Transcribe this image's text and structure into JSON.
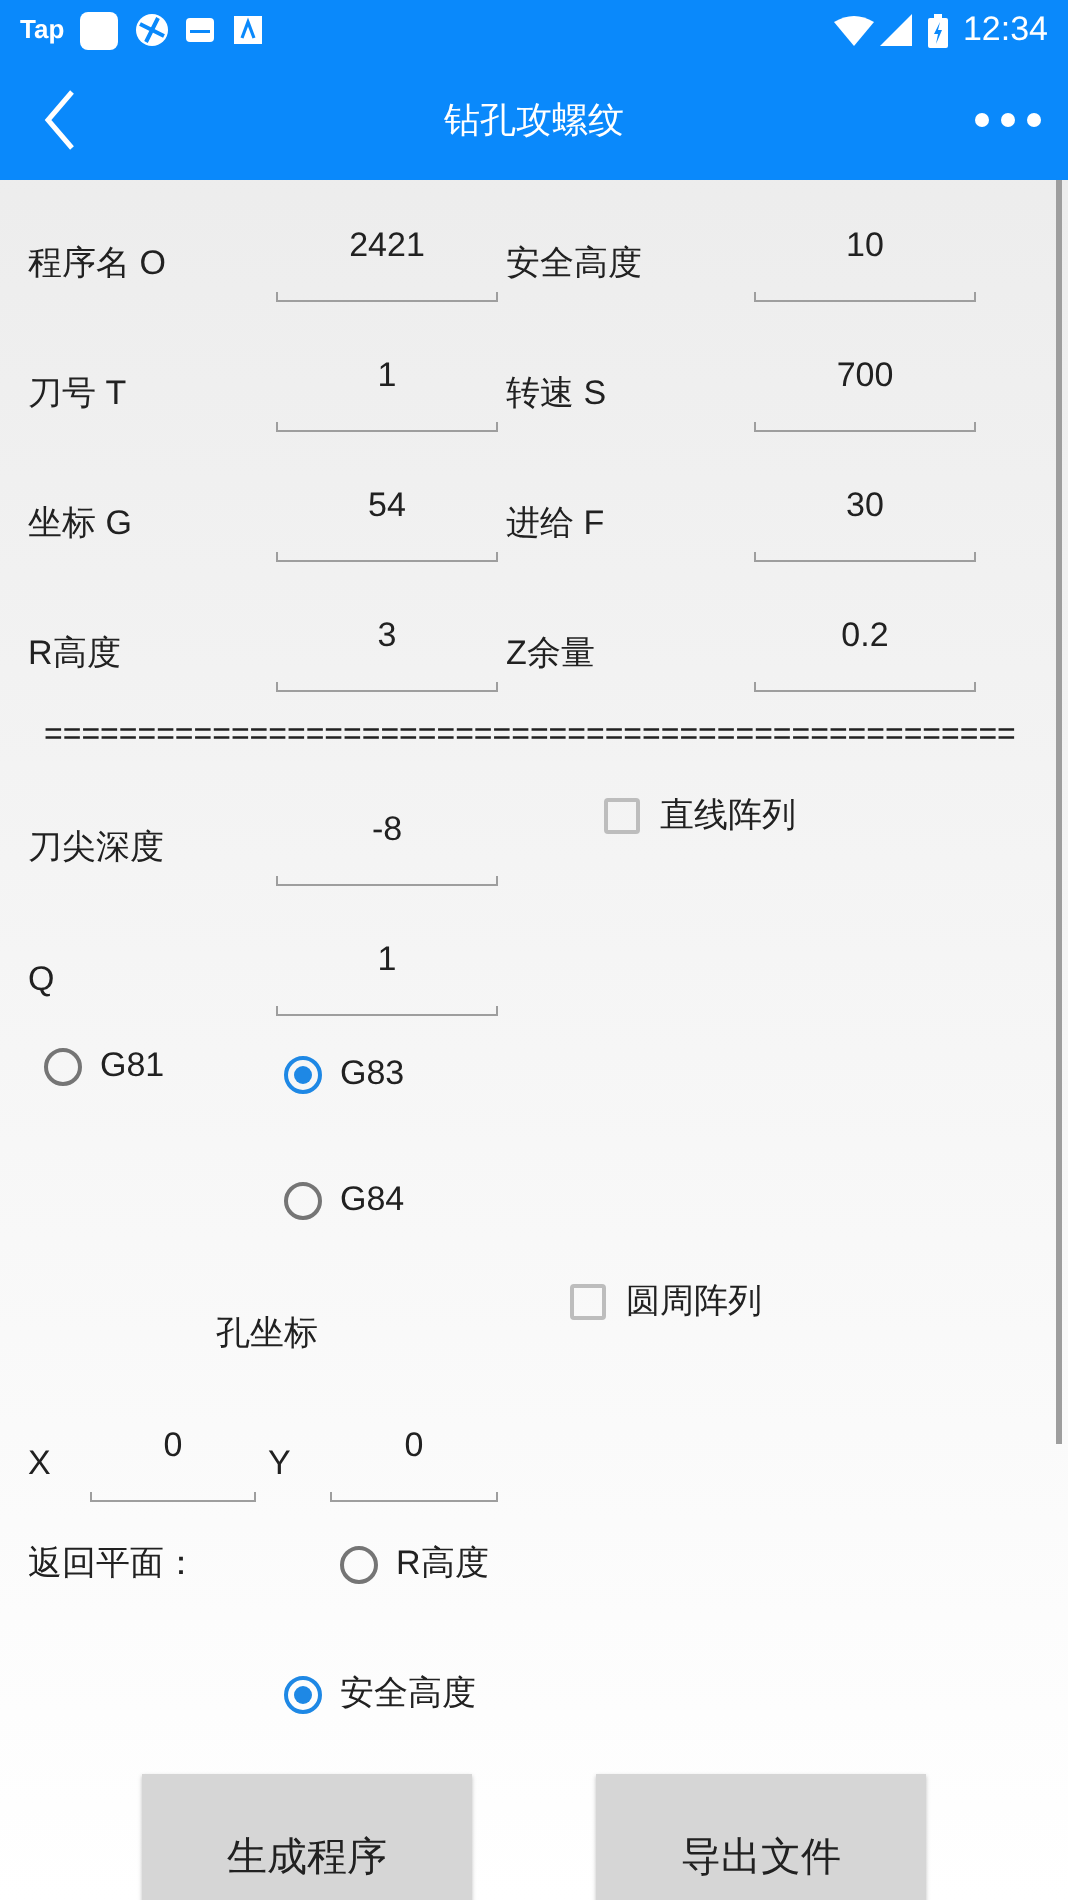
{
  "status_bar": {
    "app_label": "Tap",
    "time": "12:34"
  },
  "app_bar": {
    "title": "钻孔攻螺纹"
  },
  "param_rows": [
    {
      "left": {
        "label": "程序名 O",
        "value": "2421"
      },
      "right": {
        "label": "安全高度",
        "value": "10"
      }
    },
    {
      "left": {
        "label": "刀号 T",
        "value": "1"
      },
      "right": {
        "label": "转速 S",
        "value": "700"
      }
    },
    {
      "left": {
        "label": "坐标 G",
        "value": "54"
      },
      "right": {
        "label": "进给 F",
        "value": "30"
      }
    },
    {
      "left": {
        "label": "R高度",
        "value": "3"
      },
      "right": {
        "label": "Z余量",
        "value": "0.2"
      }
    }
  ],
  "separator": "====================================================",
  "tip_depth": {
    "label": "刀尖深度",
    "value": "-8"
  },
  "linear_array": {
    "label": "直线阵列",
    "checked": false
  },
  "q": {
    "label": "Q",
    "value": "1"
  },
  "cycle_options": [
    {
      "label": "G81",
      "selected": false
    },
    {
      "label": "G83",
      "selected": true
    },
    {
      "label": "G84",
      "selected": false
    }
  ],
  "hole_coords": {
    "title": "孔坐标",
    "x": {
      "label": "X",
      "value": "0"
    },
    "y": {
      "label": "Y",
      "value": "0"
    }
  },
  "circular_array": {
    "label": "圆周阵列",
    "checked": false
  },
  "return_plane": {
    "label": "返回平面：",
    "options": [
      {
        "label": "R高度",
        "selected": false
      },
      {
        "label": "安全高度",
        "selected": true
      }
    ]
  },
  "buttons": [
    "生成程序",
    "导出文件"
  ]
}
